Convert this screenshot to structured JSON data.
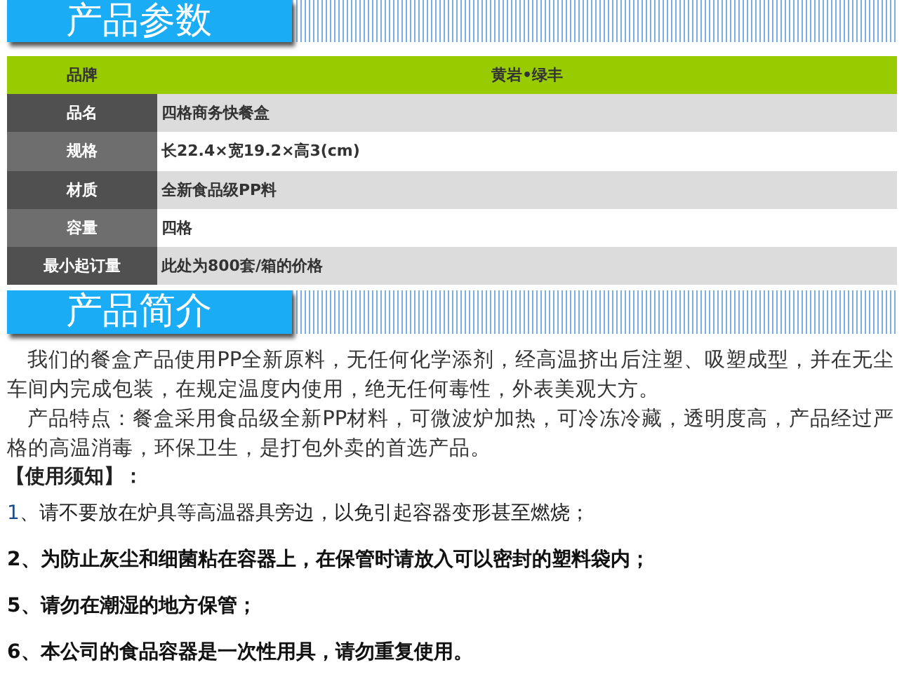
{
  "sections": [
    {
      "title": "产品参数"
    },
    {
      "title": "产品简介"
    }
  ],
  "spec_table": {
    "header": {
      "label": "品牌",
      "value": "黄岩•绿丰"
    },
    "rows": [
      {
        "label": "品名",
        "value": "四格商务快餐盒"
      },
      {
        "label": "规格",
        "value": "长22.4×宽19.2×高3(cm)"
      },
      {
        "label": "材质",
        "value": "全新食品级PP料"
      },
      {
        "label": "容量",
        "value": "四格"
      },
      {
        "label": "最小起订量",
        "value": "此处为800套/箱的价格"
      }
    ]
  },
  "intro": [
    "我们的餐盒产品使用PP全新原料，无任何化学添剂，经高温挤出后注塑、吸塑成型，并在无尘车间内完成包装，在规定温度内使用，绝无任何毒性，外表美观大方。",
    "产品特点：餐盒采用食品级全新PP材料，可微波炉加热，可冷冻冷藏，透明度高，产品经过严格的高温消毒，环保卫生，是打包外卖的首选产品。"
  ],
  "notice": {
    "heading": "【使用须知】：",
    "items": [
      {
        "kind": "plain",
        "number": "1",
        "text": "、请不要放在炉具等高温器具旁边，以免引起容器变形甚至燃烧；"
      },
      {
        "kind": "bold",
        "number": "2",
        "text": "、为防止灰尘和细菌粘在容器上，在保管时请放入可以密封的塑料袋内；"
      },
      {
        "kind": "bold",
        "number": "5",
        "text": "、请勿在潮湿的地方保管；"
      },
      {
        "kind": "bold",
        "number": "6",
        "text": "、本公司的食品容器是一次性用具，请勿重复使用。"
      }
    ]
  }
}
